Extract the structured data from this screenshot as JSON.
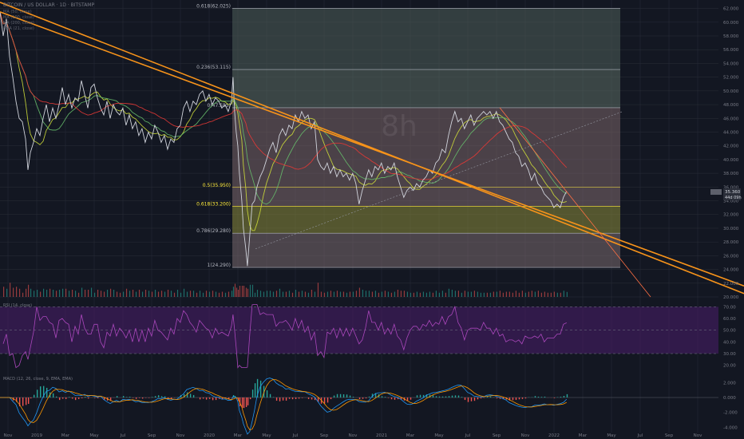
{
  "symbol_header": "BITCOIN / US DOLLAR · 1D · BITSTAMP",
  "indicators_header": [
    "MA (50, close)",
    "MA (100, close)",
    "MA (200, close)",
    "EMA (21, close)"
  ],
  "rsi_title": "RSI (14, close)",
  "macd_title": "MACD (12, 26, close, 9, EMA, EMA)",
  "price_badge": "35.360",
  "price_badge_sub": "44d 09h",
  "watermark": "8h",
  "colors": {
    "background": "#131722",
    "grid": "#2a2e39",
    "trendline": "#f7931a",
    "fib_line": "#ffeb3b",
    "rsi": "#ab47bc",
    "rsi_band": "#4a1d6b",
    "macd": "#2196f3",
    "signal": "#ff9800",
    "hist_up": "#26a69a",
    "hist_down": "#ef5350",
    "price": "#d1d4dc",
    "ma_red": "#e53935",
    "ma_yellow": "#cddc39",
    "ma_green": "#66bb6a"
  },
  "chart_data": [
    {
      "type": "line",
      "panel": "price",
      "y_axis_ticks": [
        "62.000",
        "60.000",
        "58.000",
        "56.000",
        "54.000",
        "52.000",
        "50.000",
        "48.000",
        "46.000",
        "44.000",
        "42.000",
        "40.000",
        "38.000",
        "36.000",
        "34.000",
        "32.000",
        "30.000",
        "28.000",
        "26.000",
        "24.000",
        "22.000",
        "20.000"
      ],
      "ylim": [
        20000,
        63000
      ],
      "x_axis_ticks": [
        "Nov",
        "2019",
        "Mar",
        "May",
        "Jul",
        "Sep",
        "Nov",
        "2020",
        "Mar",
        "May",
        "Jul",
        "Sep",
        "Nov",
        "2021",
        "Mar",
        "May",
        "Jul",
        "Sep",
        "Nov",
        "2022",
        "Mar",
        "May",
        "Jul",
        "Sep",
        "Nov"
      ],
      "fib_levels": [
        {
          "label": "0.618(62.025)",
          "value": 62025
        },
        {
          "label": "0.236(53.115)",
          "value": 53115
        },
        {
          "label": "0(47.555)",
          "value": 47555
        },
        {
          "label": "0.5(35.950)",
          "value": 35950
        },
        {
          "label": "0.618(33.200)",
          "value": 33200
        },
        {
          "label": "0.786(29.280)",
          "value": 29280
        },
        {
          "label": "1(24.290)",
          "value": 24290
        }
      ],
      "price_series": [
        [
          0,
          61500
        ],
        [
          4,
          58000
        ],
        [
          8,
          60500
        ],
        [
          12,
          55000
        ],
        [
          16,
          52000
        ],
        [
          20,
          48500
        ],
        [
          24,
          46000
        ],
        [
          28,
          45500
        ],
        [
          32,
          43000
        ],
        [
          35,
          38500
        ],
        [
          38,
          41000
        ],
        [
          42,
          42500
        ],
        [
          46,
          44500
        ],
        [
          50,
          43500
        ],
        [
          54,
          46000
        ],
        [
          58,
          48000
        ],
        [
          62,
          45500
        ],
        [
          66,
          47500
        ],
        [
          70,
          46000
        ],
        [
          74,
          48000
        ],
        [
          78,
          50500
        ],
        [
          82,
          48000
        ],
        [
          86,
          49500
        ],
        [
          90,
          47500
        ],
        [
          94,
          49000
        ],
        [
          98,
          48500
        ],
        [
          102,
          51500
        ],
        [
          106,
          49500
        ],
        [
          110,
          47500
        ],
        [
          114,
          50500
        ],
        [
          118,
          51000
        ],
        [
          122,
          49000
        ],
        [
          126,
          47500
        ],
        [
          130,
          46500
        ],
        [
          134,
          48500
        ],
        [
          138,
          46000
        ],
        [
          142,
          48000
        ],
        [
          146,
          47000
        ],
        [
          150,
          46500
        ],
        [
          154,
          47500
        ],
        [
          158,
          45000
        ],
        [
          162,
          46500
        ],
        [
          166,
          44500
        ],
        [
          170,
          45500
        ],
        [
          174,
          43500
        ],
        [
          178,
          44500
        ],
        [
          182,
          42500
        ],
        [
          186,
          44000
        ],
        [
          190,
          43000
        ],
        [
          194,
          45000
        ],
        [
          198,
          44000
        ],
        [
          202,
          42500
        ],
        [
          206,
          43500
        ],
        [
          210,
          41500
        ],
        [
          214,
          43000
        ],
        [
          218,
          42500
        ],
        [
          222,
          44500
        ],
        [
          226,
          45000
        ],
        [
          230,
          47500
        ],
        [
          234,
          48500
        ],
        [
          238,
          47000
        ],
        [
          242,
          48500
        ],
        [
          246,
          48000
        ],
        [
          250,
          49500
        ],
        [
          254,
          50000
        ],
        [
          258,
          48500
        ],
        [
          262,
          49500
        ],
        [
          266,
          48000
        ],
        [
          270,
          49000
        ],
        [
          274,
          48500
        ],
        [
          278,
          47500
        ],
        [
          282,
          48000
        ],
        [
          286,
          47000
        ],
        [
          290,
          48500
        ],
        [
          292,
          52000
        ],
        [
          294,
          47000
        ],
        [
          296,
          44000
        ],
        [
          298,
          42000
        ],
        [
          300,
          38000
        ],
        [
          303,
          34000
        ],
        [
          305,
          30000
        ],
        [
          308,
          27000
        ],
        [
          310,
          24500
        ],
        [
          313,
          29000
        ],
        [
          316,
          33500
        ],
        [
          319,
          34000
        ],
        [
          322,
          36000
        ],
        [
          326,
          37500
        ],
        [
          330,
          38500
        ],
        [
          334,
          40000
        ],
        [
          338,
          41500
        ],
        [
          342,
          42500
        ],
        [
          346,
          41000
        ],
        [
          350,
          43500
        ],
        [
          354,
          44500
        ],
        [
          358,
          43500
        ],
        [
          362,
          45000
        ],
        [
          366,
          44500
        ],
        [
          370,
          46500
        ],
        [
          374,
          45500
        ],
        [
          378,
          47000
        ],
        [
          382,
          46000
        ],
        [
          386,
          46500
        ],
        [
          390,
          44500
        ],
        [
          394,
          45500
        ],
        [
          398,
          40000
        ],
        [
          402,
          39000
        ],
        [
          406,
          38500
        ],
        [
          410,
          39500
        ],
        [
          414,
          38000
        ],
        [
          418,
          39000
        ],
        [
          422,
          37500
        ],
        [
          426,
          38500
        ],
        [
          430,
          37500
        ],
        [
          434,
          38000
        ],
        [
          438,
          37000
        ],
        [
          442,
          38000
        ],
        [
          446,
          36500
        ],
        [
          450,
          33500
        ],
        [
          454,
          35500
        ],
        [
          458,
          37000
        ],
        [
          462,
          38500
        ],
        [
          466,
          37500
        ],
        [
          470,
          39000
        ],
        [
          474,
          38500
        ],
        [
          478,
          39500
        ],
        [
          482,
          38000
        ],
        [
          486,
          39000
        ],
        [
          490,
          38500
        ],
        [
          494,
          39500
        ],
        [
          498,
          37500
        ],
        [
          502,
          36000
        ],
        [
          506,
          34500
        ],
        [
          510,
          35500
        ],
        [
          514,
          36000
        ],
        [
          518,
          35500
        ],
        [
          522,
          36500
        ],
        [
          526,
          36000
        ],
        [
          530,
          37000
        ],
        [
          534,
          37500
        ],
        [
          538,
          38500
        ],
        [
          542,
          38000
        ],
        [
          546,
          39500
        ],
        [
          550,
          40000
        ],
        [
          554,
          41500
        ],
        [
          558,
          41000
        ],
        [
          562,
          43500
        ],
        [
          566,
          45500
        ],
        [
          570,
          47000
        ],
        [
          574,
          45500
        ],
        [
          578,
          46000
        ],
        [
          582,
          44500
        ],
        [
          586,
          45500
        ],
        [
          590,
          46500
        ],
        [
          594,
          45000
        ],
        [
          598,
          46000
        ],
        [
          602,
          46500
        ],
        [
          606,
          47000
        ],
        [
          610,
          46500
        ],
        [
          614,
          47000
        ],
        [
          618,
          46000
        ],
        [
          622,
          47000
        ],
        [
          626,
          45500
        ],
        [
          630,
          45000
        ],
        [
          634,
          44000
        ],
        [
          638,
          43000
        ],
        [
          642,
          42500
        ],
        [
          646,
          41000
        ],
        [
          650,
          40500
        ],
        [
          654,
          39000
        ],
        [
          658,
          39500
        ],
        [
          662,
          38500
        ],
        [
          666,
          37000
        ],
        [
          670,
          38000
        ],
        [
          674,
          36500
        ],
        [
          678,
          36000
        ],
        [
          682,
          35000
        ],
        [
          686,
          34500
        ],
        [
          690,
          34000
        ],
        [
          694,
          33000
        ],
        [
          698,
          33500
        ],
        [
          702,
          33000
        ],
        [
          706,
          34500
        ],
        [
          710,
          35400
        ]
      ],
      "price_xlim": [
        0,
        932
      ],
      "trendlines": [
        {
          "name": "",
          "start": [
            0,
            62900
          ],
          "end": [
            932,
            20500
          ]
        },
        {
          "name": "",
          "start": [
            0,
            61500
          ],
          "end": [
            932,
            21600
          ]
        }
      ],
      "watermark_level": 44000
    },
    {
      "type": "line",
      "panel": "rsi",
      "title": "RSI (14, close)",
      "y_axis_ticks": [
        "70.00",
        "60.00",
        "50.00",
        "40.00",
        "30.00",
        "20.00"
      ],
      "ylim": [
        15,
        75
      ],
      "upper_band": 70,
      "lower_band": 30
    },
    {
      "type": "line",
      "panel": "macd",
      "title": "MACD (12, 26, close, 9, EMA, EMA)",
      "y_axis_ticks": [
        "2.000",
        "0.000",
        "-2.000",
        "-4.000"
      ],
      "ylim": [
        -4500,
        3000
      ]
    }
  ]
}
